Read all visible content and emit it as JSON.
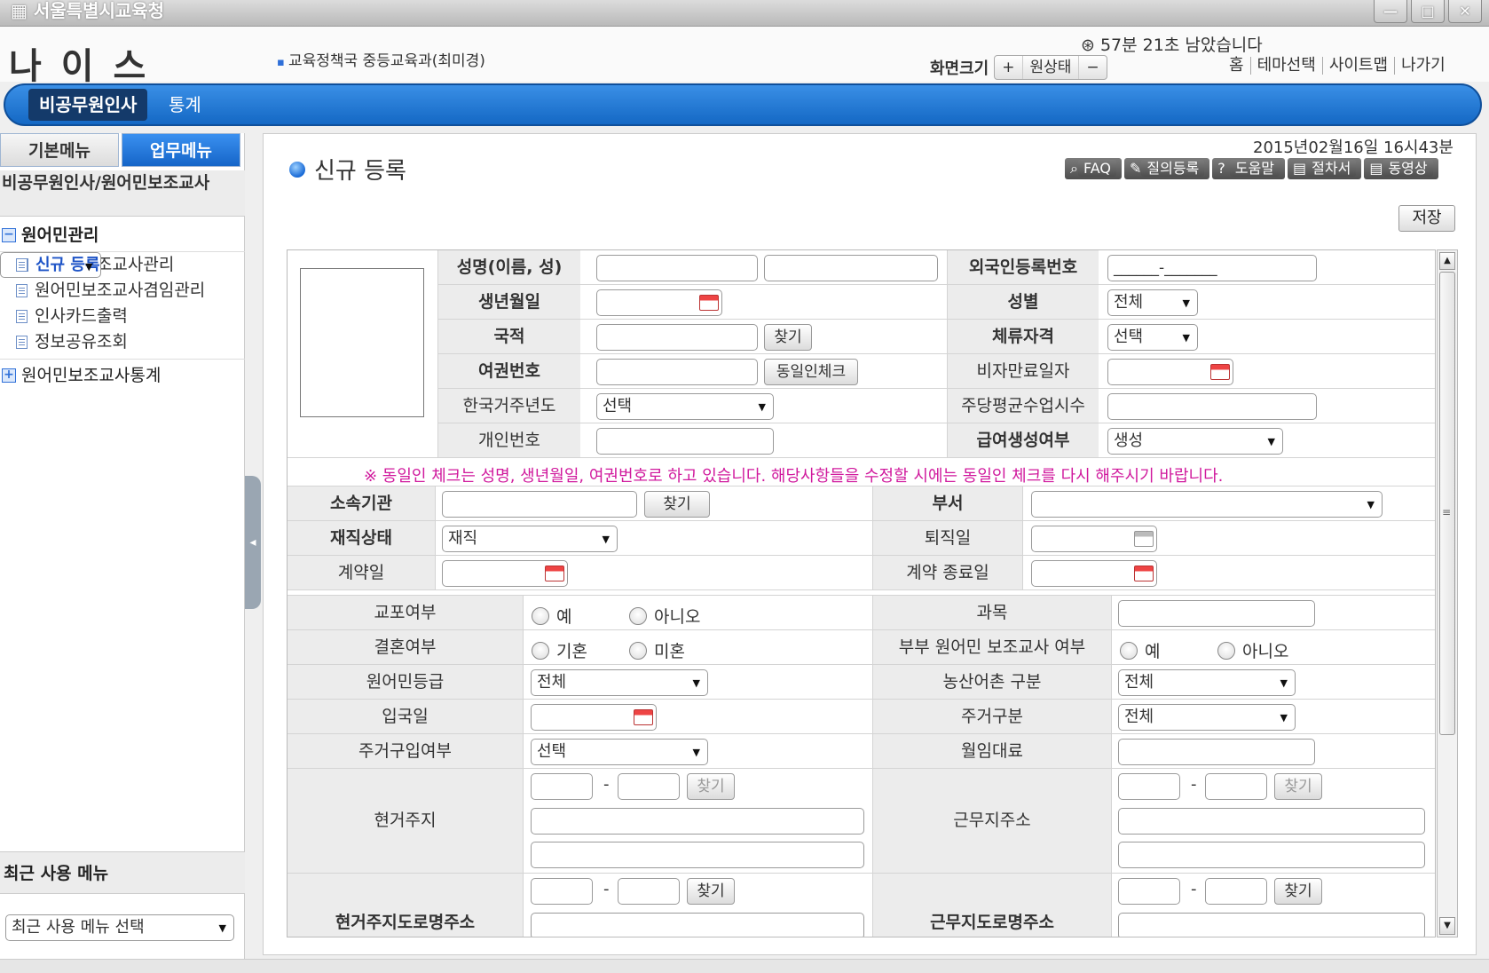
{
  "window": {
    "title": "서울특별시교육청",
    "btn_min": "—",
    "btn_max": "□",
    "btn_close": "✕"
  },
  "header": {
    "logo": "나 이 스",
    "org": "교육정책국 중등교육과(최미경)",
    "timer": "57분 21초 남았습니다",
    "screen_label": "화면크기",
    "zoom_in": "+",
    "zoom_reset": "원상태",
    "zoom_out": "−",
    "links": [
      "홈",
      "테마선택",
      "사이트맵",
      "나가기"
    ]
  },
  "nav": {
    "active": "비공무원인사",
    "item": "통계"
  },
  "sidebar": {
    "tab_basic": "기본메뉴",
    "tab_work": "업무메뉴",
    "title": "비공무원인사/원어민보조교사",
    "group1": "원어민관리",
    "items": [
      "신규 등록",
      "원어민보조교사관리",
      "원어민보조교사겸임관리",
      "인사카드출력",
      "정보공유조회"
    ],
    "group2": "원어민보조교사통계",
    "recent_title": "최근 사용 메뉴",
    "recent_select": "최근 사용 메뉴 선택"
  },
  "page": {
    "title": "신규 등록",
    "datetime": "2015년02월16일 16시43분",
    "buttons": [
      "FAQ",
      "질의등록",
      "도움말",
      "절차서",
      "동영상"
    ],
    "save": "저장"
  },
  "form": {
    "name_label": "성명(이름, 성)",
    "alien_label": "외국인등록번호",
    "alien_value": "______-_______",
    "birth_label": "생년월일",
    "gender_label": "성별",
    "gender_value": "전체",
    "nation_label": "국적",
    "find": "찾기",
    "status_label": "체류자격",
    "status_value": "선택",
    "passport_label": "여권번호",
    "dup_check": "동일인체크",
    "visa_label": "비자만료일자",
    "stay_label": "한국거주년도",
    "stay_value": "선택",
    "weekly_label": "주당평균수업시수",
    "personal_label": "개인번호",
    "pay_label": "급여생성여부",
    "pay_value": "생성",
    "notice": "※ 동일인 체크는 성명, 생년월일, 여권번호로 하고 있습니다. 해당사항들을 수정할 시에는 동일인 체크를 다시 해주시기 바랍니다.",
    "org_label": "소속기관",
    "dept_label": "부서",
    "work_label": "재직상태",
    "work_value": "재직",
    "retire_label": "퇴직일",
    "contract_label": "계약일",
    "contract_end_label": "계약 종료일",
    "invite_label": "교포여부",
    "yes": "예",
    "no": "아니오",
    "subject_label": "과목",
    "marry_label": "결혼여부",
    "married": "기혼",
    "single": "미혼",
    "couple_label": "부부 원어민 보조교사 여부",
    "grade_label": "원어민등급",
    "grade_value": "전체",
    "rural_label": "농산어촌 구분",
    "rural_value": "전체",
    "entry_label": "입국일",
    "house_label": "주거구분",
    "house_value": "전체",
    "house_buy_label": "주거구입여부",
    "house_buy_value": "선택",
    "rent_label": "월임대료",
    "addr_label": "현거주지",
    "work_addr_label": "근무지주소",
    "road_addr_label": "현거주지도로명주소",
    "road_work_label": "근무지도로명주소",
    "dash": "-"
  }
}
